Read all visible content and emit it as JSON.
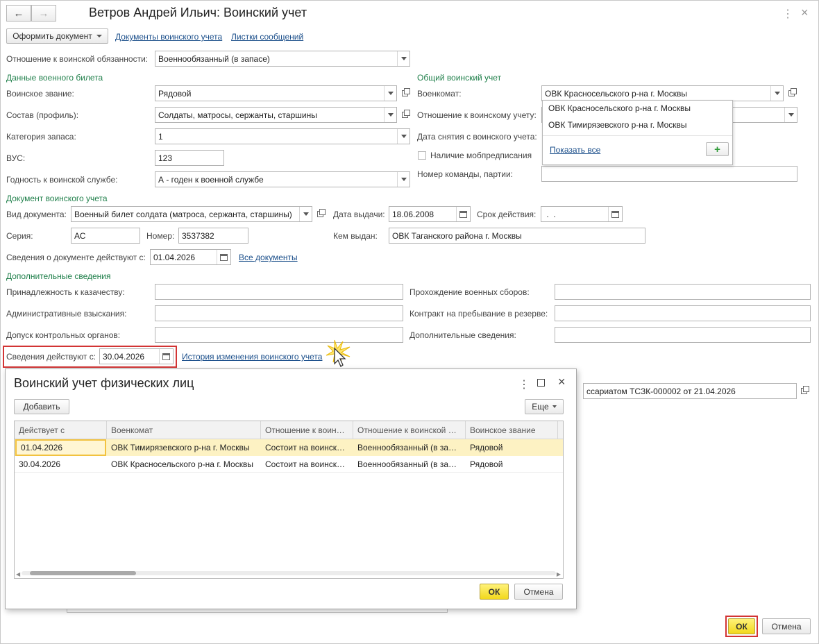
{
  "window": {
    "title": "Ветров Андрей Ильич: Воинский учет"
  },
  "toolbar": {
    "create_doc_label": "Оформить документ",
    "link_docs": "Документы воинского учета",
    "link_messages": "Листки сообщений"
  },
  "form": {
    "obligation_label": "Отношение к воинской обязанности:",
    "obligation_value": "Военнообязанный (в запасе)",
    "section_ticket": "Данные военного билета",
    "rank_label": "Воинское звание:",
    "rank_value": "Рядовой",
    "composition_label": "Состав (профиль):",
    "composition_value": "Солдаты, матросы, сержанты, старшины",
    "reserve_label": "Категория запаса:",
    "reserve_value": "1",
    "vus_label": "ВУС:",
    "vus_value": "123",
    "fitness_label": "Годность к воинской службе:",
    "fitness_value": "А - годен к военной службе",
    "section_general": "Общий воинский учет",
    "commissariat_label": "Военкомат:",
    "commissariat_value": "ОВК Красносельского р-на г. Москвы",
    "attitude_label": "Отношение к воинскому учету:",
    "removal_label": "Дата снятия с воинского учета:",
    "mob_label": "Наличие мобпредписания",
    "team_label": "Номер команды, партии:",
    "section_doc": "Документ воинского учета",
    "doctype_label": "Вид документа:",
    "doctype_value": "Военный билет солдата (матроса, сержанта, старшины)",
    "issue_date_label": "Дата выдачи:",
    "issue_date_value": "18.06.2008",
    "validity_label": "Срок действия:",
    "validity_value": " .  .",
    "series_label": "Серия:",
    "series_value": "АС",
    "number_label": "Номер:",
    "number_value": "3537382",
    "issuer_label": "Кем выдан:",
    "issuer_value": "ОВК Таганского района г. Москвы",
    "doc_valid_from_label": "Сведения о документе действуют с:",
    "doc_valid_from_value": "01.04.2026",
    "all_docs_link": "Все документы",
    "section_extra": "Дополнительные сведения",
    "cossack_label": "Принадлежность к казачеству:",
    "penalties_label": "Административные взыскания:",
    "control_label": "Допуск контрольных органов:",
    "training_label": "Прохождение военных сборов:",
    "contract_label": "Контракт на пребывание в резерве:",
    "extra_info_label": "Дополнительные сведения:",
    "valid_from_label": "Сведения действуют с:",
    "valid_from_value": "30.04.2026",
    "history_link": "История изменения воинского учета",
    "bg_partial_value": "ссариатом ТСЗК-000002 от 21.04.2026"
  },
  "dropdown": {
    "items": [
      "ОВК Красносельского р-на г. Москвы",
      "ОВК Тимирязевского р-на г. Москвы"
    ],
    "show_all": "Показать все",
    "plus_icon": "+"
  },
  "footer": {
    "ok_label": "ОК",
    "cancel_label": "Отмена"
  },
  "modal": {
    "title": "Воинский учет физических лиц",
    "add_label": "Добавить",
    "more_label": "Еще",
    "columns": [
      "Действует с",
      "Военкомат",
      "Отношение к воин…",
      "Отношение к воинской …",
      "Воинское звание"
    ],
    "rows": [
      [
        "01.04.2026",
        "ОВК Тимирязевского р-на г. Москвы",
        "Состоит на воинск…",
        "Военнообязанный (в за…",
        "Рядовой"
      ],
      [
        "30.04.2026",
        "ОВК Красносельского р-на г. Москвы",
        "Состоит на воинск…",
        "Военнообязанный (в за…",
        "Рядовой"
      ]
    ],
    "ok_label": "ОК",
    "cancel_label": "Отмена"
  },
  "colors": {
    "section_green": "#1f7f4a",
    "link_blue": "#1a4e8a",
    "ok_yellow": "#f2d81c",
    "highlight_red": "#d23434",
    "selected_row": "#fdf2c3"
  }
}
